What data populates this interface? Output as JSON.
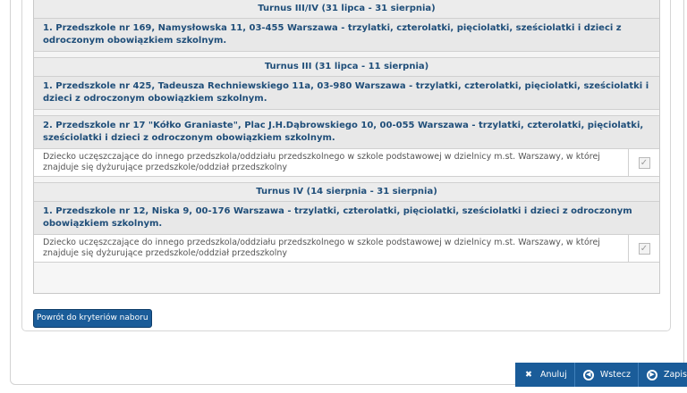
{
  "turnusy": [
    {
      "header": "Turnus III/IV (31 lipca - 31 sierpnia)",
      "schools": [
        {
          "name": "1. Przedszkole nr 169, Namysłowska 11, 03-455 Warszawa - trzylatki, czterolatki, pięciolatki, sześciolatki i dzieci z odroczonym obowiązkiem szkolnym.",
          "option": null
        }
      ]
    },
    {
      "header": "Turnus III (31 lipca - 11 sierpnia)",
      "schools": [
        {
          "name": "1. Przedszkole nr 425, Tadeusza Rechniewskiego 11a, 03-980 Warszawa - trzylatki, czterolatki, pięciolatki, sześciolatki i dzieci z odroczonym obowiązkiem szkolnym.",
          "option": null
        },
        {
          "name": "2. Przedszkole nr 17 \"Kółko Graniaste\", Plac J.H.Dąbrowskiego 10, 00-055 Warszawa - trzylatki, czterolatki, pięciolatki, sześciolatki i dzieci z odroczonym obowiązkiem szkolnym.",
          "option": "Dziecko uczęszczające do innego przedszkola/oddziału przedszkolnego w szkole podstawowej w dzielnicy m.st. Warszawy, w której znajduje się dyżurujące przedszkole/oddział przedszkolny"
        }
      ]
    },
    {
      "header": "Turnus IV (14 sierpnia - 31 sierpnia)",
      "schools": [
        {
          "name": "1. Przedszkole nr 12, Niska 9, 00-176 Warszawa - trzylatki, czterolatki, pięciolatki, sześciolatki i dzieci z odroczonym obowiązkiem szkolnym.",
          "option": "Dziecko uczęszczające do innego przedszkola/oddziału przedszkolnego w szkole podstawowej w dzielnicy m.st. Warszawy, w której znajduje się dyżurujące przedszkole/oddział przedszkolny"
        }
      ]
    }
  ],
  "checkbox_checked": true,
  "back_button": "Powrót do kryteriów naboru",
  "actions": {
    "cancel": "Anuluj",
    "back": "Wstecz",
    "save": "Zapisz"
  },
  "colors": {
    "accent": "#1a5c99",
    "heading_text": "#1f4e79"
  }
}
